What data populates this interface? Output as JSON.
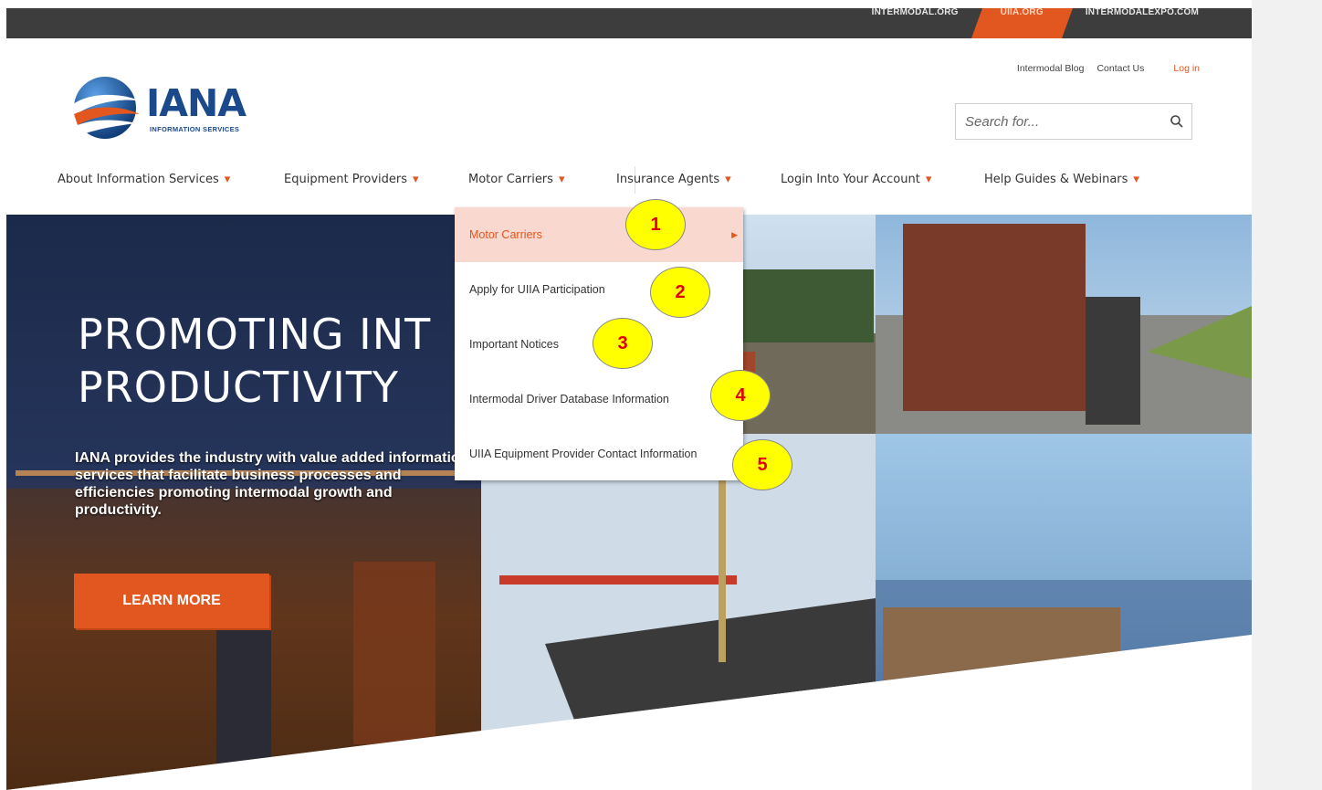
{
  "topbar": {
    "sites": [
      {
        "label": "INTERMODAL.ORG",
        "active": false
      },
      {
        "label": "UIIA.ORG",
        "active": true
      },
      {
        "label": "INTERMODALEXPO.COM",
        "active": false
      }
    ]
  },
  "header": {
    "logo_text": "IANA",
    "logo_sub": "INFORMATION SERVICES",
    "links": {
      "blog": "Intermodal Blog",
      "contact": "Contact Us",
      "login": "Log in"
    },
    "search_placeholder": "Search for..."
  },
  "nav": {
    "items": [
      {
        "label": "About Information Services"
      },
      {
        "label": "Equipment Providers"
      },
      {
        "label": "Motor Carriers"
      },
      {
        "label": "Insurance Agents"
      },
      {
        "label": "Login Into Your Account"
      },
      {
        "label": "Help Guides & Webinars"
      }
    ]
  },
  "dropdown": {
    "items": [
      {
        "label": "Motor Carriers",
        "active": true
      },
      {
        "label": "Apply for UIIA Participation"
      },
      {
        "label": "Important Notices"
      },
      {
        "label": "Intermodal Driver Database Information"
      },
      {
        "label": "UIIA Equipment Provider Contact Information"
      }
    ]
  },
  "hero": {
    "title_line1": "PROMOTING INT",
    "title_line2": "PRODUCTIVITY",
    "text": "IANA provides the industry with value added information services that facilitate business processes and efficiencies promoting intermodal growth and productivity.",
    "button": "LEARN MORE"
  },
  "callouts": [
    "1",
    "2",
    "3",
    "4",
    "5"
  ],
  "colors": {
    "accent": "#e2561f",
    "topbar": "#3d3d3d",
    "brand_blue": "#1b4a8c",
    "callout": "#ffff00"
  }
}
